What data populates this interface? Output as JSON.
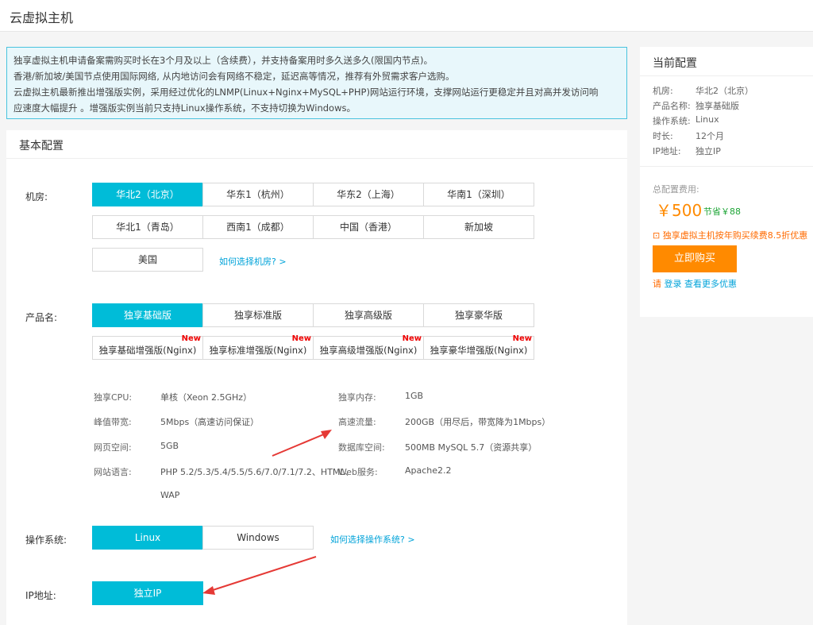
{
  "header": {
    "title": "云虚拟主机"
  },
  "notice": {
    "line1": "独享虚拟主机申请备案需购买时长在3个月及以上（含续费），并支持备案用时多久送多久(限国内节点)。",
    "line2": "香港/新加坡/美国节点使用国际网络, 从内地访问会有网络不稳定，延迟高等情况，推荐有外贸需求客户选购。",
    "line3": "云虚拟主机最新推出增强版实例，采用经过优化的LNMP(Linux+Nginx+MySQL+PHP)网站运行环境，支撑网站运行更稳定并且对高并发访问响",
    "line4": "应速度大幅提升 。增强版实例当前只支持Linux操作系统，不支持切换为Windows。"
  },
  "basic": {
    "title": "基本配置",
    "region": {
      "label": "机房:",
      "options": [
        "华北2（北京）",
        "华东1（杭州）",
        "华东2（上海）",
        "华南1（深圳）",
        "华北1（青岛）",
        "西南1（成都）",
        "中国（香港）",
        "新加坡",
        "美国"
      ],
      "help": "如何选择机房? >"
    },
    "product": {
      "label": "产品名:",
      "options": [
        "独享基础版",
        "独享标准版",
        "独享高级版",
        "独享豪华版",
        "独享基础增强版(Nginx)",
        "独享标准增强版(Nginx)",
        "独享高级增强版(Nginx)",
        "独享豪华增强版(Nginx)"
      ],
      "new_badge": "New"
    },
    "specs": {
      "cpu_k": "独享CPU:",
      "cpu_v": "单核（Xeon 2.5GHz）",
      "mem_k": "独享内存:",
      "mem_v": "1GB",
      "bw_k": "峰值带宽:",
      "bw_v": "5Mbps（高速访问保证）",
      "traffic_k": "高速流量:",
      "traffic_v": "200GB（用尽后，带宽降为1Mbps）",
      "web_k": "网页空间:",
      "web_v": "5GB",
      "db_k": "数据库空间:",
      "db_v": "500MB MySQL 5.7（资源共享）",
      "lang_k": "网站语言:",
      "lang_v1": "PHP 5.2/5.3/5.4/5.5/5.6/7.0/7.1/7.2、HTML、",
      "lang_v2": "WAP",
      "server_k": "Web服务:",
      "server_v": "Apache2.2"
    },
    "os": {
      "label": "操作系统:",
      "options": [
        "Linux",
        "Windows"
      ],
      "help": "如何选择操作系统? >"
    },
    "ip": {
      "label": "IP地址:",
      "option": "独立IP"
    }
  },
  "side": {
    "title": "当前配置",
    "rows": [
      {
        "k": "机房:",
        "v": "华北2（北京）"
      },
      {
        "k": "产品名称:",
        "v": "独享基础版"
      },
      {
        "k": "操作系统:",
        "v": "Linux"
      },
      {
        "k": "时长:",
        "v": "12个月"
      },
      {
        "k": "IP地址:",
        "v": "独立IP"
      }
    ],
    "price_label": "总配置费用:",
    "price": "￥500",
    "save": "节省￥88",
    "promo": "独享虚拟主机按年购买续费8.5折优惠",
    "buy": "立即购买",
    "login_pre": "请",
    "login_link": "登录",
    "login_post": "查看更多优惠"
  },
  "colors": {
    "accent": "#00bcd8",
    "orange": "#ff8a00",
    "annotation_arrow": "#e53935"
  }
}
